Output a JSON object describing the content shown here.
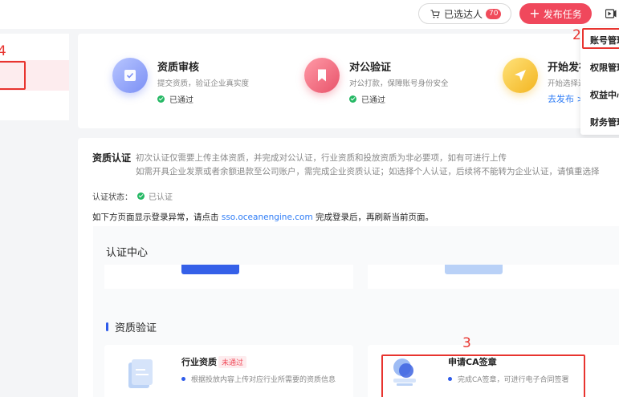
{
  "header": {
    "selected_label": "已选达人",
    "selected_count": "70",
    "publish_label": "发布任务"
  },
  "steps": [
    {
      "title": "资质审核",
      "desc": "提交资质，验证企业真实度",
      "status": "已通过"
    },
    {
      "title": "对公验证",
      "desc": "对公打款，保障账号身份安全",
      "status": "已通过"
    },
    {
      "title": "开始发布",
      "desc": "开始选择达",
      "link": "去发布 >"
    }
  ],
  "dropdown": {
    "items": [
      "账号管理",
      "权限管理",
      "权益中心",
      "财务管理"
    ]
  },
  "qualification": {
    "title": "资质认证",
    "line1": "初次认证仅需要上传主体资质，并完成对公认证，行业资质和投放资质为非必要项，如有可进行上传",
    "line2": "如需开具企业发票或者余额退款至公司账户，需完成企业资质认证；如选择个人认证，后续将不能转为企业认证，请慎重选择",
    "status_label": "认证状态：",
    "status_value": "已认证",
    "login_note_pre": "如下方页面显示登录异常，请点击",
    "login_link": "sso.oceanengine.com",
    "login_note_post": "完成登录后，再刷新当前页面。"
  },
  "auth_center": {
    "title": "认证中心",
    "section_title": "资质验证",
    "cards": [
      {
        "name": "行业资质",
        "tag": "未通过",
        "desc": "根据投放内容上传对应行业所需要的资质信息"
      },
      {
        "name": "申请CA签章",
        "desc": "完成CA签章，可进行电子合同签署"
      }
    ]
  },
  "annotations": [
    "2",
    "3",
    "4"
  ],
  "colors": {
    "accent": "#f0485c",
    "link": "#2e7cf6",
    "success": "#25b864",
    "annotation": "#e8342f"
  }
}
